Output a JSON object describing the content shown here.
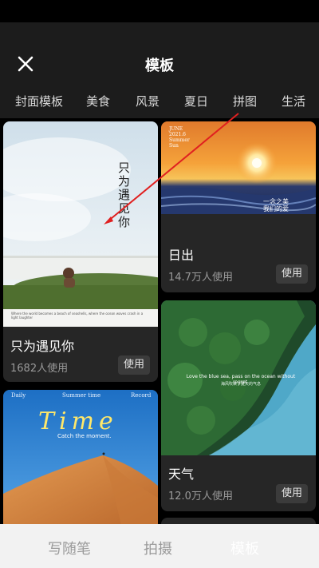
{
  "header": {
    "title": "模板"
  },
  "tabs": [
    {
      "label": "封面模板"
    },
    {
      "label": "美食"
    },
    {
      "label": "风景"
    },
    {
      "label": "夏日"
    },
    {
      "label": "拼图"
    },
    {
      "label": "生活"
    }
  ],
  "cards": [
    {
      "title": "只为遇见你",
      "count": "1682人使用",
      "use_label": "使用",
      "poster": {
        "vertical_text": "只为遇见你",
        "footer_text": "Where the world becomes a beach of seashells, where the ocean waves crash in a light laughter"
      }
    },
    {
      "title": "日出",
      "count": "14.7万人使用",
      "use_label": "使用",
      "poster": {
        "top_text": [
          "JUNE",
          "2021.6",
          "Summer",
          "Sun"
        ],
        "script_text": [
          "一念之美",
          "我们的爱"
        ]
      }
    },
    {
      "title": "天气",
      "count": "12.0万人使用",
      "use_label": "使用",
      "poster": {
        "caption": "Love the blue sea, pass on the ocean without regret.",
        "subcaption": "海风吹来了夏天的气息"
      }
    },
    {
      "poster": {
        "header_left": "Daily",
        "header_center": "Summer time",
        "header_right": "Record",
        "script_word": "Time",
        "tagline": "Catch the moment."
      }
    }
  ],
  "bottom_nav": [
    {
      "label": "写随笔"
    },
    {
      "label": "拍摄"
    },
    {
      "label": "模板"
    }
  ],
  "colors": {
    "header_bg": "#1c1c1c",
    "card_bg": "#262626",
    "use_button_bg": "#3b3b3b",
    "annotation_arrow": "#e02020",
    "bottom_nav_bg": "#f2f2f2"
  }
}
